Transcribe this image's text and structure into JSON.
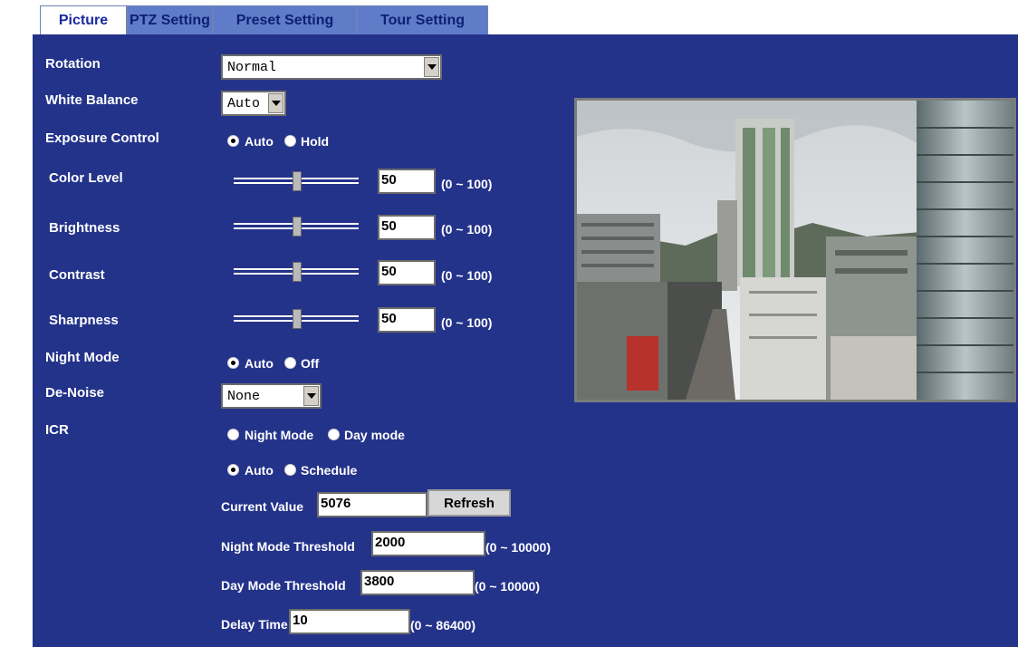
{
  "tabs": {
    "picture": "Picture",
    "ptz": "PTZ Setting",
    "preset": "Preset Setting",
    "tour": "Tour Setting"
  },
  "rotation": {
    "label": "Rotation",
    "value": "Normal"
  },
  "white_balance": {
    "label": "White Balance",
    "value": "Auto"
  },
  "exposure": {
    "label": "Exposure Control",
    "opt1": "Auto",
    "opt2": "Hold",
    "selected": "Auto"
  },
  "sliders": {
    "color": {
      "label": "Color Level",
      "value": "50",
      "range": "(0 ~ 100)"
    },
    "brightness": {
      "label": "Brightness",
      "value": "50",
      "range": "(0 ~ 100)"
    },
    "contrast": {
      "label": "Contrast",
      "value": "50",
      "range": "(0 ~ 100)"
    },
    "sharpness": {
      "label": "Sharpness",
      "value": "50",
      "range": "(0 ~ 100)"
    }
  },
  "night_mode": {
    "label": "Night Mode",
    "opt1": "Auto",
    "opt2": "Off",
    "selected": "Auto"
  },
  "denoise": {
    "label": "De-Noise",
    "value": "None"
  },
  "icr": {
    "label": "ICR",
    "mode_opt1": "Night Mode",
    "mode_opt2": "Day mode",
    "sched_opt1": "Auto",
    "sched_opt2": "Schedule",
    "sched_selected": "Auto",
    "current_label": "Current Value",
    "current_value": "5076",
    "refresh": "Refresh",
    "night_threshold_label": "Night Mode Threshold",
    "night_threshold_value": "2000",
    "night_threshold_range": "(0 ~ 10000)",
    "day_threshold_label": "Day Mode Threshold",
    "day_threshold_value": "3800",
    "day_threshold_range": "(0 ~ 10000)",
    "delay_label": "Delay Time",
    "delay_value": "10",
    "delay_range": "(0 ~ 86400)"
  },
  "colors": {
    "panel": "#24338a",
    "tab": "#5f7cc9",
    "tab_text": "#0d1f74"
  }
}
